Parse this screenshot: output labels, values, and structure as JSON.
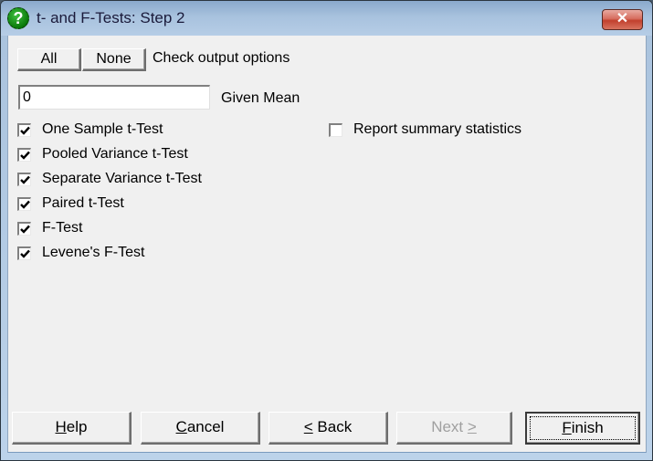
{
  "window": {
    "title": "t- and F-Tests: Step 2",
    "title_icon": "help-question-icon",
    "close_glyph": "✕"
  },
  "top_controls": {
    "all_label": "All",
    "none_label": "None",
    "hint": "Check output options"
  },
  "given_mean": {
    "value": "0",
    "label": "Given Mean"
  },
  "options_left": [
    {
      "label": "One Sample t-Test",
      "checked": true
    },
    {
      "label": "Pooled Variance t-Test",
      "checked": true
    },
    {
      "label": "Separate Variance t-Test",
      "checked": true
    },
    {
      "label": "Paired t-Test",
      "checked": true
    },
    {
      "label": "F-Test",
      "checked": true
    },
    {
      "label": "Levene's F-Test",
      "checked": true
    }
  ],
  "options_right": [
    {
      "label": "Report summary statistics",
      "checked": false
    }
  ],
  "footer": {
    "help": {
      "mnemonic": "H",
      "rest": "elp"
    },
    "cancel": {
      "mnemonic": "C",
      "rest": "ancel"
    },
    "back": {
      "mnemonic": "<",
      "rest": " Back"
    },
    "next": {
      "pre": "Next ",
      "mnemonic": ">"
    },
    "finish": {
      "mnemonic": "F",
      "rest": "inish"
    }
  }
}
